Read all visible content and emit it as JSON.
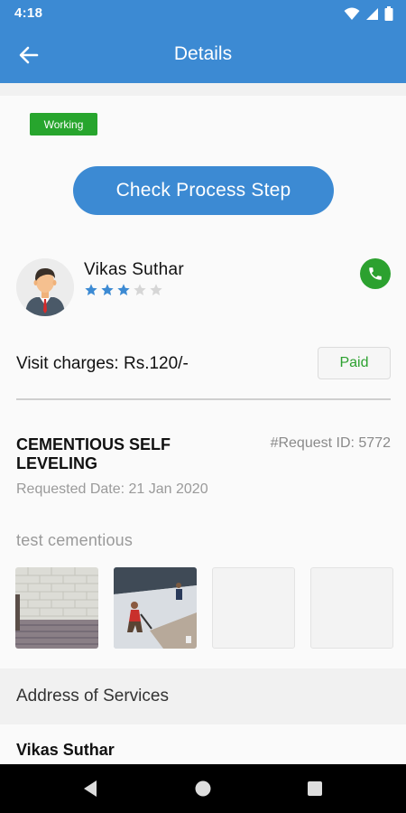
{
  "status_bar": {
    "time": "4:18"
  },
  "app_bar": {
    "title": "Details"
  },
  "status_badge": "Working",
  "process_button": "Check Process Step",
  "provider": {
    "name": "Vikas Suthar",
    "rating": 3,
    "max_rating": 5
  },
  "visit_charges": "Visit charges: Rs.120/-",
  "payment_status": "Paid",
  "service": {
    "title": "CEMENTIOUS SELF LEVELING",
    "request_id": "#Request ID: 5772",
    "requested_date": "Requested Date: 21 Jan 2020",
    "description": "test cementious"
  },
  "address": {
    "section_title": "Address of Services",
    "name": "Vikas Suthar"
  },
  "colors": {
    "primary": "#3c8ad3",
    "success": "#2ca12f",
    "star_filled": "#3c8ad3",
    "star_empty": "#d6d6d6"
  },
  "icons": {
    "back": "arrow-left-icon",
    "call": "phone-icon",
    "wifi": "wifi-icon",
    "signal": "signal-icon",
    "battery": "battery-icon"
  }
}
